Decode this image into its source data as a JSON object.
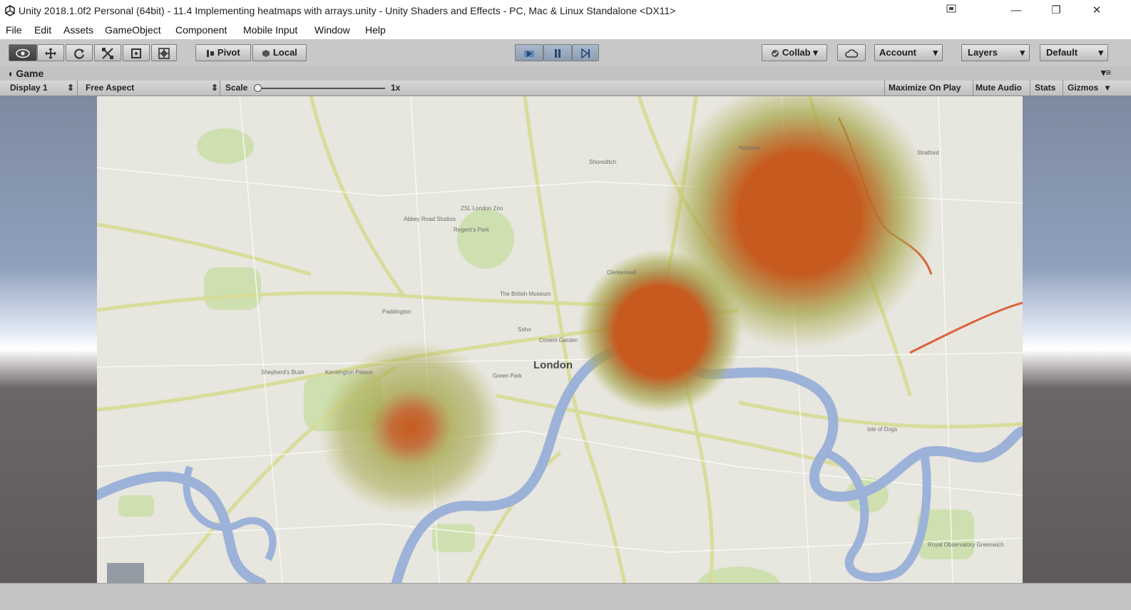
{
  "window": {
    "title": "Unity 2018.1.0f2 Personal (64bit) - 11.4 Implementing heatmaps with arrays.unity - Unity Shaders and Effects - PC, Mac & Linux Standalone <DX11>",
    "minimize": "—",
    "maximize": "❐",
    "close": "✕"
  },
  "menu": [
    "File",
    "Edit",
    "Assets",
    "GameObject",
    "Component",
    "Mobile Input",
    "Window",
    "Help"
  ],
  "toolbar": {
    "pivot": "Pivot",
    "local": "Local",
    "collab": "Collab",
    "account": "Account",
    "layers": "Layers",
    "layout": "Default"
  },
  "game_tab": {
    "title": "Game",
    "display": "Display 1",
    "aspect": "Free Aspect",
    "scale_label": "Scale",
    "scale_value": "1x",
    "maximize_on_play": "Maximize On Play",
    "mute_audio": "Mute Audio",
    "stats": "Stats",
    "gizmos": "Gizmos"
  },
  "map": {
    "city_label": "London",
    "places": [
      "Stratford",
      "Isle of Dogs",
      "Royal Observatory Greenwich",
      "The British Museum",
      "Covent Garden",
      "Soho",
      "Kensington Palace",
      "Green Park",
      "Shepherd's Bush",
      "Paddington",
      "Regent's Park",
      "ZSL London Zoo",
      "Abbey Road Studios",
      "Shoreditch",
      "Hackney",
      "Clerkenwell"
    ],
    "heatmap_points": 3
  },
  "colors": {
    "heat_core": "#c75a1f",
    "heat_mid": "#a6a64a",
    "river": "#9db2d8",
    "map_bg": "#e7e6df",
    "park": "#cfe0b0",
    "road": "#d8dc9a"
  }
}
